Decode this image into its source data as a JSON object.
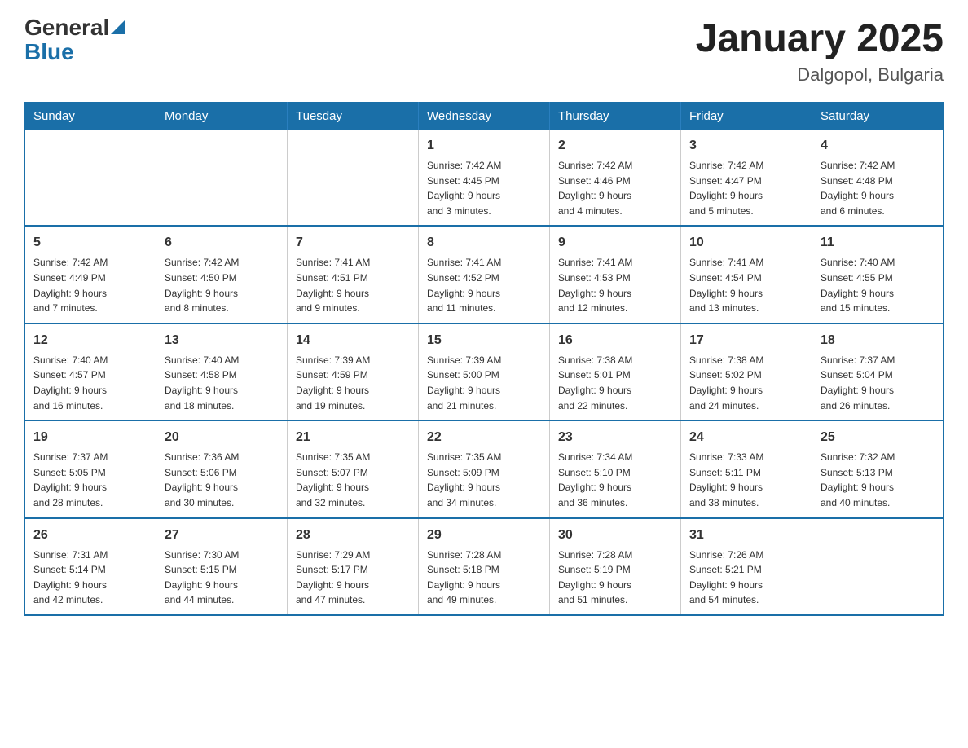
{
  "header": {
    "logo_general": "General",
    "logo_blue": "Blue",
    "title": "January 2025",
    "subtitle": "Dalgopol, Bulgaria"
  },
  "weekdays": [
    "Sunday",
    "Monday",
    "Tuesday",
    "Wednesday",
    "Thursday",
    "Friday",
    "Saturday"
  ],
  "weeks": [
    [
      {
        "day": "",
        "info": ""
      },
      {
        "day": "",
        "info": ""
      },
      {
        "day": "",
        "info": ""
      },
      {
        "day": "1",
        "info": "Sunrise: 7:42 AM\nSunset: 4:45 PM\nDaylight: 9 hours\nand 3 minutes."
      },
      {
        "day": "2",
        "info": "Sunrise: 7:42 AM\nSunset: 4:46 PM\nDaylight: 9 hours\nand 4 minutes."
      },
      {
        "day": "3",
        "info": "Sunrise: 7:42 AM\nSunset: 4:47 PM\nDaylight: 9 hours\nand 5 minutes."
      },
      {
        "day": "4",
        "info": "Sunrise: 7:42 AM\nSunset: 4:48 PM\nDaylight: 9 hours\nand 6 minutes."
      }
    ],
    [
      {
        "day": "5",
        "info": "Sunrise: 7:42 AM\nSunset: 4:49 PM\nDaylight: 9 hours\nand 7 minutes."
      },
      {
        "day": "6",
        "info": "Sunrise: 7:42 AM\nSunset: 4:50 PM\nDaylight: 9 hours\nand 8 minutes."
      },
      {
        "day": "7",
        "info": "Sunrise: 7:41 AM\nSunset: 4:51 PM\nDaylight: 9 hours\nand 9 minutes."
      },
      {
        "day": "8",
        "info": "Sunrise: 7:41 AM\nSunset: 4:52 PM\nDaylight: 9 hours\nand 11 minutes."
      },
      {
        "day": "9",
        "info": "Sunrise: 7:41 AM\nSunset: 4:53 PM\nDaylight: 9 hours\nand 12 minutes."
      },
      {
        "day": "10",
        "info": "Sunrise: 7:41 AM\nSunset: 4:54 PM\nDaylight: 9 hours\nand 13 minutes."
      },
      {
        "day": "11",
        "info": "Sunrise: 7:40 AM\nSunset: 4:55 PM\nDaylight: 9 hours\nand 15 minutes."
      }
    ],
    [
      {
        "day": "12",
        "info": "Sunrise: 7:40 AM\nSunset: 4:57 PM\nDaylight: 9 hours\nand 16 minutes."
      },
      {
        "day": "13",
        "info": "Sunrise: 7:40 AM\nSunset: 4:58 PM\nDaylight: 9 hours\nand 18 minutes."
      },
      {
        "day": "14",
        "info": "Sunrise: 7:39 AM\nSunset: 4:59 PM\nDaylight: 9 hours\nand 19 minutes."
      },
      {
        "day": "15",
        "info": "Sunrise: 7:39 AM\nSunset: 5:00 PM\nDaylight: 9 hours\nand 21 minutes."
      },
      {
        "day": "16",
        "info": "Sunrise: 7:38 AM\nSunset: 5:01 PM\nDaylight: 9 hours\nand 22 minutes."
      },
      {
        "day": "17",
        "info": "Sunrise: 7:38 AM\nSunset: 5:02 PM\nDaylight: 9 hours\nand 24 minutes."
      },
      {
        "day": "18",
        "info": "Sunrise: 7:37 AM\nSunset: 5:04 PM\nDaylight: 9 hours\nand 26 minutes."
      }
    ],
    [
      {
        "day": "19",
        "info": "Sunrise: 7:37 AM\nSunset: 5:05 PM\nDaylight: 9 hours\nand 28 minutes."
      },
      {
        "day": "20",
        "info": "Sunrise: 7:36 AM\nSunset: 5:06 PM\nDaylight: 9 hours\nand 30 minutes."
      },
      {
        "day": "21",
        "info": "Sunrise: 7:35 AM\nSunset: 5:07 PM\nDaylight: 9 hours\nand 32 minutes."
      },
      {
        "day": "22",
        "info": "Sunrise: 7:35 AM\nSunset: 5:09 PM\nDaylight: 9 hours\nand 34 minutes."
      },
      {
        "day": "23",
        "info": "Sunrise: 7:34 AM\nSunset: 5:10 PM\nDaylight: 9 hours\nand 36 minutes."
      },
      {
        "day": "24",
        "info": "Sunrise: 7:33 AM\nSunset: 5:11 PM\nDaylight: 9 hours\nand 38 minutes."
      },
      {
        "day": "25",
        "info": "Sunrise: 7:32 AM\nSunset: 5:13 PM\nDaylight: 9 hours\nand 40 minutes."
      }
    ],
    [
      {
        "day": "26",
        "info": "Sunrise: 7:31 AM\nSunset: 5:14 PM\nDaylight: 9 hours\nand 42 minutes."
      },
      {
        "day": "27",
        "info": "Sunrise: 7:30 AM\nSunset: 5:15 PM\nDaylight: 9 hours\nand 44 minutes."
      },
      {
        "day": "28",
        "info": "Sunrise: 7:29 AM\nSunset: 5:17 PM\nDaylight: 9 hours\nand 47 minutes."
      },
      {
        "day": "29",
        "info": "Sunrise: 7:28 AM\nSunset: 5:18 PM\nDaylight: 9 hours\nand 49 minutes."
      },
      {
        "day": "30",
        "info": "Sunrise: 7:28 AM\nSunset: 5:19 PM\nDaylight: 9 hours\nand 51 minutes."
      },
      {
        "day": "31",
        "info": "Sunrise: 7:26 AM\nSunset: 5:21 PM\nDaylight: 9 hours\nand 54 minutes."
      },
      {
        "day": "",
        "info": ""
      }
    ]
  ]
}
